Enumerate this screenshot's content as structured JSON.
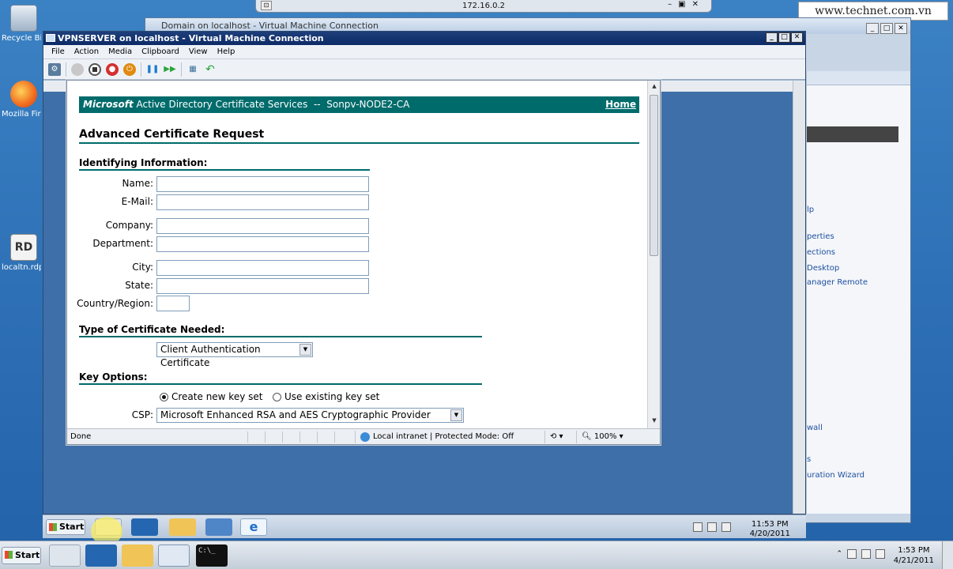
{
  "host": {
    "desktop_icons": [
      {
        "label": "Recycle Bin"
      },
      {
        "label": "Mozilla Firefox"
      },
      {
        "label": "localtn.rdp"
      }
    ],
    "rdp_bar_address": "172.16.0.2",
    "watermark": "www.technet.com.vn",
    "background_window_title": "Domain on localhost - Virtual Machine Connection",
    "start_label": "Start",
    "clock_time": "1:53 PM",
    "clock_date": "4/21/2011"
  },
  "server_panel": {
    "links": [
      "lp",
      "perties",
      "ections",
      "Desktop",
      "anager Remote",
      "wall",
      "s",
      "uration Wizard"
    ]
  },
  "vm": {
    "title": "VPNSERVER on localhost - Virtual Machine Connection",
    "menu": [
      "File",
      "Action",
      "Media",
      "Clipboard",
      "View",
      "Help"
    ],
    "toolbar_icons": [
      "ctrl-alt-del-icon",
      "start-icon",
      "turn-off-icon",
      "shut-down-icon",
      "save-icon",
      "pause-icon",
      "resume-icon",
      "snapshot-icon",
      "revert-icon"
    ],
    "taskbar": {
      "start_label": "Start",
      "clock_time": "11:53 PM",
      "clock_date": "4/20/2011"
    }
  },
  "ie": {
    "status_text": "Done",
    "zone_text": "Local intranet | Protected Mode: Off",
    "zoom": "100%"
  },
  "page": {
    "banner_brand": "Microsoft",
    "banner_text": "Active Directory Certificate Services  --  Sonpv-NODE2-CA",
    "home_link": "Home",
    "title": "Advanced Certificate Request",
    "identifying_heading": "Identifying Information:",
    "fields": {
      "name": "Name:",
      "email": "E-Mail:",
      "company": "Company:",
      "department": "Department:",
      "city": "City:",
      "state": "State:",
      "country": "Country/Region:"
    },
    "cert_type_heading": "Type of Certificate Needed:",
    "cert_type_value": "Client Authentication Certificate",
    "key_options_heading": "Key Options:",
    "radio_new": "Create new key set",
    "radio_existing": "Use existing key set",
    "csp_label": "CSP:",
    "csp_value": "Microsoft Enhanced RSA and AES Cryptographic Provider"
  },
  "colors": {
    "adcs_teal": "#006b6b",
    "vm_title_bar": "#0b2a66",
    "desktop_blue": "#2c6db3"
  }
}
